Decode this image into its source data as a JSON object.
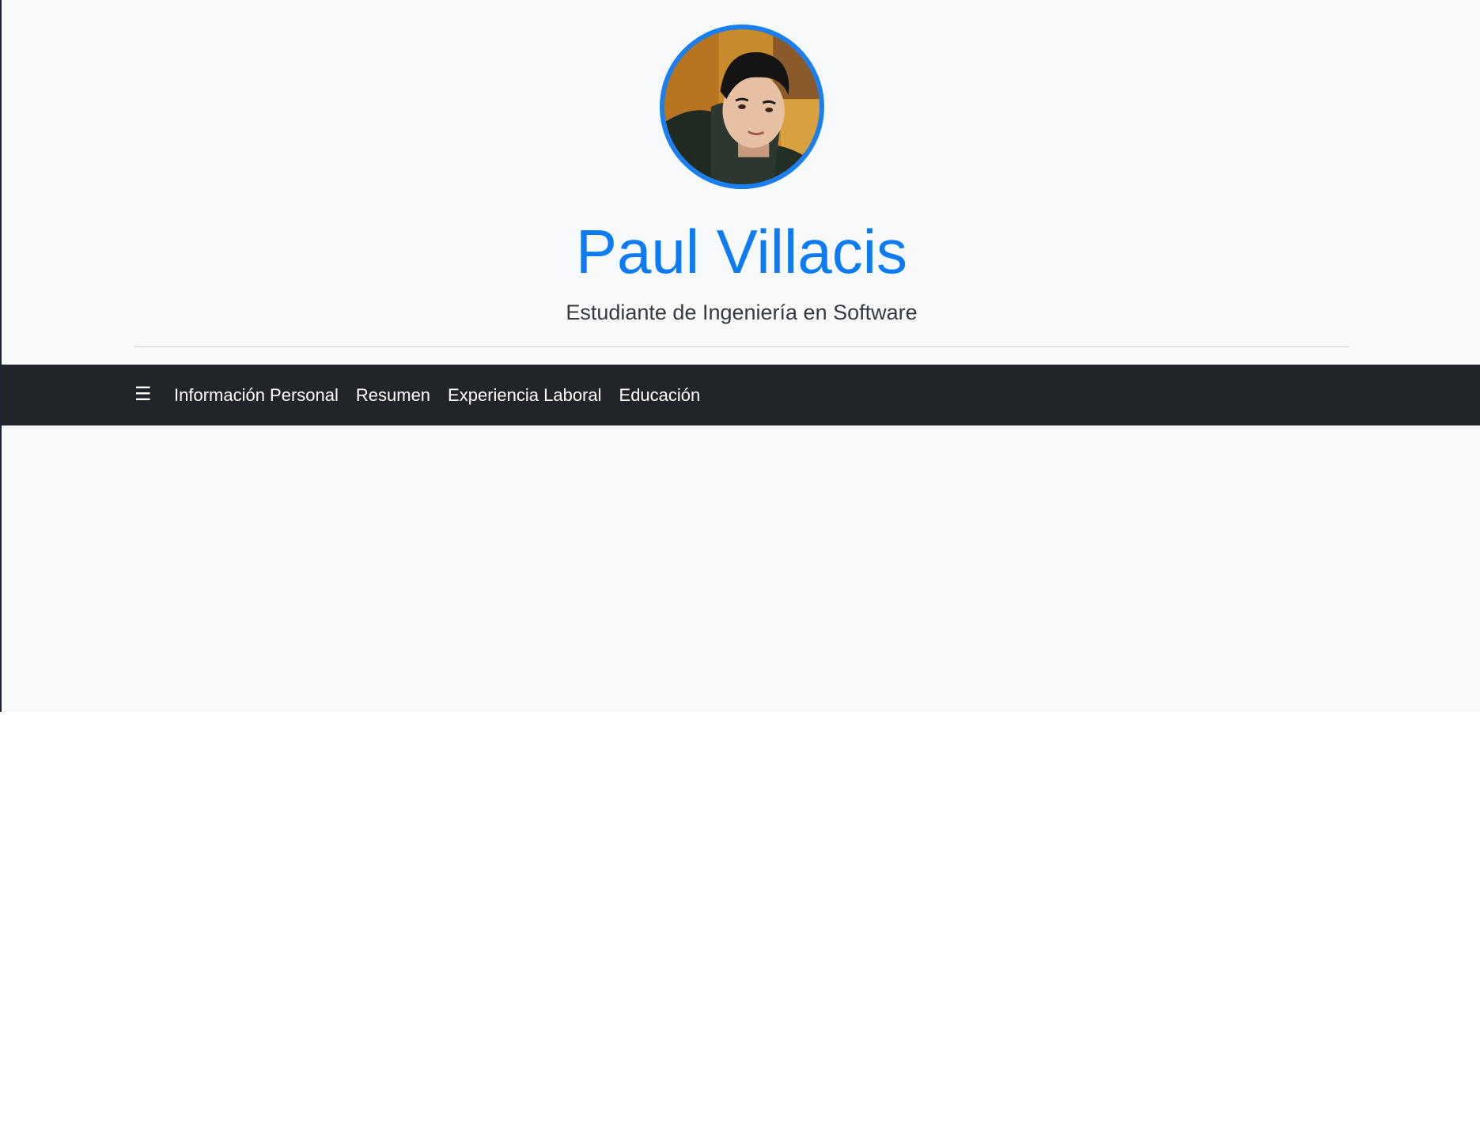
{
  "profile": {
    "name": "Paul Villacis",
    "title": "Estudiante de Ingeniería en Software",
    "avatar_icon": "profile-photo"
  },
  "navbar": {
    "toggle_icon": "hamburger-menu-icon",
    "toggle_glyph": "☰",
    "items": [
      {
        "label": "Información Personal"
      },
      {
        "label": "Resumen"
      },
      {
        "label": "Experiencia Laboral"
      },
      {
        "label": "Educación"
      }
    ]
  },
  "colors": {
    "accent": "#0d7bf2",
    "navbar_bg": "#212529",
    "page_bg": "#f8f9fa"
  }
}
